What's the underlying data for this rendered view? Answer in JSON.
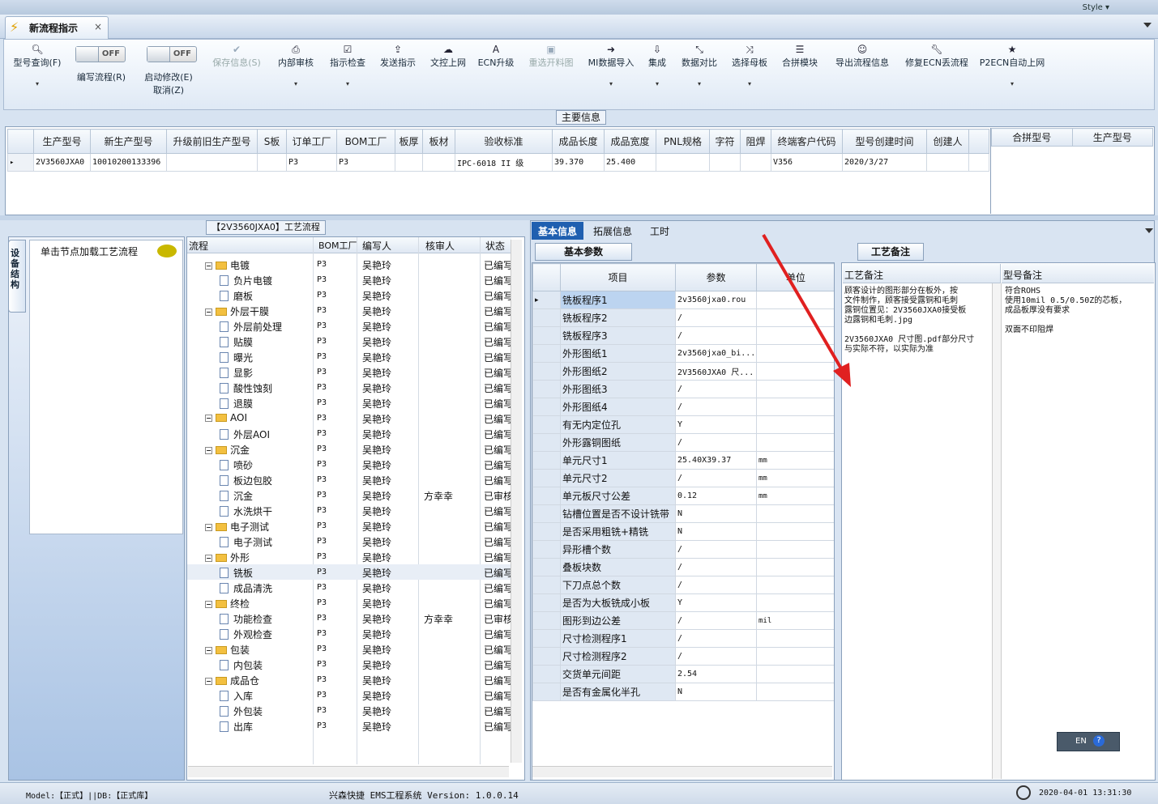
{
  "top": {
    "style_label": "Style ▾"
  },
  "tab": {
    "title": "新流程指示",
    "close": "×"
  },
  "toolbar": {
    "model_query": "型号查询(F)",
    "edit_flow": "编写流程(R)",
    "edit_flow_toggle": "OFF",
    "start_modify": "启动修改(E)",
    "cancel": "取消(Z)",
    "start_modify_toggle": "OFF",
    "save_info": "保存信息(S)",
    "internal_review": "内部审核",
    "instruction_check": "指示检查",
    "send_instruction": "发送指示",
    "upload_doc": "文控上网",
    "ecn_upgrade": "ECN升级",
    "reopen_chart": "重选开料图",
    "mi_import": "MI数据导入",
    "integrate": "集成",
    "data_compare": "数据对比",
    "select_master": "选择母板",
    "merge_module": "合拼模块",
    "export_flow": "导出流程信息",
    "repair_ecn": "修复ECN丢流程",
    "p2ecn_upload": "P2ECN自动上网"
  },
  "main_info": {
    "label": "主要信息",
    "columns": [
      "生产型号",
      "新生产型号",
      "升级前旧生产型号",
      "S板",
      "订单工厂",
      "BOM工厂",
      "板厚",
      "板材",
      "验收标准",
      "成品长度",
      "成品宽度",
      "PNL规格",
      "字符",
      "阻焊",
      "终端客户代码",
      "型号创建时间",
      "创建人"
    ],
    "row": [
      "2V3560JXA0",
      "10010200133396",
      "",
      "",
      "P3",
      "P3",
      "",
      "",
      "IPC-6018 II 级",
      "39.370",
      "25.400",
      "",
      "",
      "",
      "V356",
      "2020/3/27",
      ""
    ],
    "side_columns": [
      "合拼型号",
      "生产型号"
    ]
  },
  "left": {
    "vtab": "设备结构",
    "load_hint": "单击节点加载工艺流程"
  },
  "tree": {
    "label": "【2V3560JXA0】工艺流程",
    "columns": [
      "流程",
      "BOM工厂",
      "编写人",
      "核审人",
      "状态"
    ],
    "rows": [
      {
        "name": "电镀",
        "type": "folder",
        "bom": "P3",
        "author": "吴艳玲",
        "reviewer": "",
        "status": "已编写"
      },
      {
        "name": "负片电镀",
        "type": "doc",
        "bom": "P3",
        "author": "吴艳玲",
        "reviewer": "",
        "status": "已编写"
      },
      {
        "name": "磨板",
        "type": "doc",
        "bom": "P3",
        "author": "吴艳玲",
        "reviewer": "",
        "status": "已编写"
      },
      {
        "name": "外层干膜",
        "type": "folder",
        "bom": "P3",
        "author": "吴艳玲",
        "reviewer": "",
        "status": "已编写"
      },
      {
        "name": "外层前处理",
        "type": "doc",
        "bom": "P3",
        "author": "吴艳玲",
        "reviewer": "",
        "status": "已编写"
      },
      {
        "name": "贴膜",
        "type": "doc",
        "bom": "P3",
        "author": "吴艳玲",
        "reviewer": "",
        "status": "已编写"
      },
      {
        "name": "曝光",
        "type": "doc",
        "bom": "P3",
        "author": "吴艳玲",
        "reviewer": "",
        "status": "已编写"
      },
      {
        "name": "显影",
        "type": "doc",
        "bom": "P3",
        "author": "吴艳玲",
        "reviewer": "",
        "status": "已编写"
      },
      {
        "name": "酸性蚀刻",
        "type": "doc",
        "bom": "P3",
        "author": "吴艳玲",
        "reviewer": "",
        "status": "已编写"
      },
      {
        "name": "退膜",
        "type": "doc",
        "bom": "P3",
        "author": "吴艳玲",
        "reviewer": "",
        "status": "已编写"
      },
      {
        "name": "AOI",
        "type": "folder",
        "bom": "P3",
        "author": "吴艳玲",
        "reviewer": "",
        "status": "已编写"
      },
      {
        "name": "外层AOI",
        "type": "doc",
        "bom": "P3",
        "author": "吴艳玲",
        "reviewer": "",
        "status": "已编写"
      },
      {
        "name": "沉金",
        "type": "folder",
        "bom": "P3",
        "author": "吴艳玲",
        "reviewer": "",
        "status": "已编写"
      },
      {
        "name": "喷砂",
        "type": "doc",
        "bom": "P3",
        "author": "吴艳玲",
        "reviewer": "",
        "status": "已编写"
      },
      {
        "name": "板边包胶",
        "type": "doc",
        "bom": "P3",
        "author": "吴艳玲",
        "reviewer": "",
        "status": "已编写"
      },
      {
        "name": "沉金",
        "type": "doc",
        "bom": "P3",
        "author": "吴艳玲",
        "reviewer": "方幸幸",
        "status": "已审核"
      },
      {
        "name": "水洗烘干",
        "type": "doc",
        "bom": "P3",
        "author": "吴艳玲",
        "reviewer": "",
        "status": "已编写"
      },
      {
        "name": "电子测试",
        "type": "folder",
        "bom": "P3",
        "author": "吴艳玲",
        "reviewer": "",
        "status": "已编写"
      },
      {
        "name": "电子测试",
        "type": "doc",
        "bom": "P3",
        "author": "吴艳玲",
        "reviewer": "",
        "status": "已编写"
      },
      {
        "name": "外形",
        "type": "folder",
        "bom": "P3",
        "author": "吴艳玲",
        "reviewer": "",
        "status": "已编写"
      },
      {
        "name": "铣板",
        "type": "doc",
        "bom": "P3",
        "author": "吴艳玲",
        "reviewer": "",
        "status": "已编写"
      },
      {
        "name": "成品清洗",
        "type": "doc",
        "bom": "P3",
        "author": "吴艳玲",
        "reviewer": "",
        "status": "已编写"
      },
      {
        "name": "终检",
        "type": "folder",
        "bom": "P3",
        "author": "吴艳玲",
        "reviewer": "",
        "status": "已编写"
      },
      {
        "name": "功能检查",
        "type": "doc",
        "bom": "P3",
        "author": "吴艳玲",
        "reviewer": "方幸幸",
        "status": "已审核"
      },
      {
        "name": "外观检查",
        "type": "doc",
        "bom": "P3",
        "author": "吴艳玲",
        "reviewer": "",
        "status": "已编写"
      },
      {
        "name": "包装",
        "type": "folder",
        "bom": "P3",
        "author": "吴艳玲",
        "reviewer": "",
        "status": "已编写"
      },
      {
        "name": "内包装",
        "type": "doc",
        "bom": "P3",
        "author": "吴艳玲",
        "reviewer": "",
        "status": "已编写"
      },
      {
        "name": "成品仓",
        "type": "folder",
        "bom": "P3",
        "author": "吴艳玲",
        "reviewer": "",
        "status": "已编写"
      },
      {
        "name": "入库",
        "type": "doc",
        "bom": "P3",
        "author": "吴艳玲",
        "reviewer": "",
        "status": "已编写"
      },
      {
        "name": "外包装",
        "type": "doc",
        "bom": "P3",
        "author": "吴艳玲",
        "reviewer": "",
        "status": "已编写"
      },
      {
        "name": "出库",
        "type": "doc",
        "bom": "P3",
        "author": "吴艳玲",
        "reviewer": "",
        "status": "已编写"
      }
    ]
  },
  "right": {
    "tabs": [
      "基本信息",
      "拓展信息",
      "工时"
    ],
    "param_label": "基本参数",
    "param_columns": [
      "项目",
      "参数",
      "单位"
    ],
    "params": [
      {
        "item": "铣板程序1",
        "value": "2v3560jxa0.rou",
        "unit": ""
      },
      {
        "item": "铣板程序2",
        "value": "/",
        "unit": ""
      },
      {
        "item": "铣板程序3",
        "value": "/",
        "unit": ""
      },
      {
        "item": "外形图纸1",
        "value": "2v3560jxa0_bi...",
        "unit": ""
      },
      {
        "item": "外形图纸2",
        "value": "2V3560JXA0 尺...",
        "unit": ""
      },
      {
        "item": "外形图纸3",
        "value": "/",
        "unit": ""
      },
      {
        "item": "外形图纸4",
        "value": "/",
        "unit": ""
      },
      {
        "item": "有无内定位孔",
        "value": "Y",
        "unit": ""
      },
      {
        "item": "外形露铜图纸",
        "value": "/",
        "unit": ""
      },
      {
        "item": "单元尺寸1",
        "value": "25.40X39.37",
        "unit": "mm"
      },
      {
        "item": "单元尺寸2",
        "value": "/",
        "unit": "mm"
      },
      {
        "item": "单元板尺寸公差",
        "value": "0.12",
        "unit": "mm"
      },
      {
        "item": "钻槽位置是否不设计铣带",
        "value": "N",
        "unit": ""
      },
      {
        "item": "是否采用粗铣+精铣",
        "value": "N",
        "unit": ""
      },
      {
        "item": "异形槽个数",
        "value": "/",
        "unit": ""
      },
      {
        "item": "叠板块数",
        "value": "/",
        "unit": ""
      },
      {
        "item": "下刀点总个数",
        "value": "/",
        "unit": ""
      },
      {
        "item": "是否为大板铣成小板",
        "value": "Y",
        "unit": ""
      },
      {
        "item": "图形到边公差",
        "value": "/",
        "unit": "mil"
      },
      {
        "item": "尺寸检测程序1",
        "value": "/",
        "unit": ""
      },
      {
        "item": "尺寸检测程序2",
        "value": "/",
        "unit": ""
      },
      {
        "item": "交货单元间距",
        "value": "2.54",
        "unit": ""
      },
      {
        "item": "是否有金属化半孔",
        "value": "N",
        "unit": ""
      }
    ],
    "note_label": "工艺备注",
    "note_columns": [
      "工艺备注",
      "型号备注"
    ],
    "process_note": "顾客设计的图形部分在板外，按\n文件制作，顾客接受露铜和毛刺\n露铜位置见：2V3560JXA0接受板\n边露铜和毛刺.jpg\n\n2V3560JXA0 尺寸图.pdf部分尺寸\n与实际不符，以实际为准",
    "model_note": "符合ROHS\n使用10mil 0.5/0.50Z的芯板，\n成品板厚没有要求\n\n双面不印阻焊",
    "lang": "EN"
  },
  "status": {
    "model": "Model:【正式】||DB:【正式库】",
    "system": "兴森快捷 EMS工程系统 Version: 1.0.0.14",
    "datetime": "2020-04-01 13:31:30"
  },
  "colors": {
    "accent": "#1f5fb0",
    "arrow": "#e02020"
  }
}
